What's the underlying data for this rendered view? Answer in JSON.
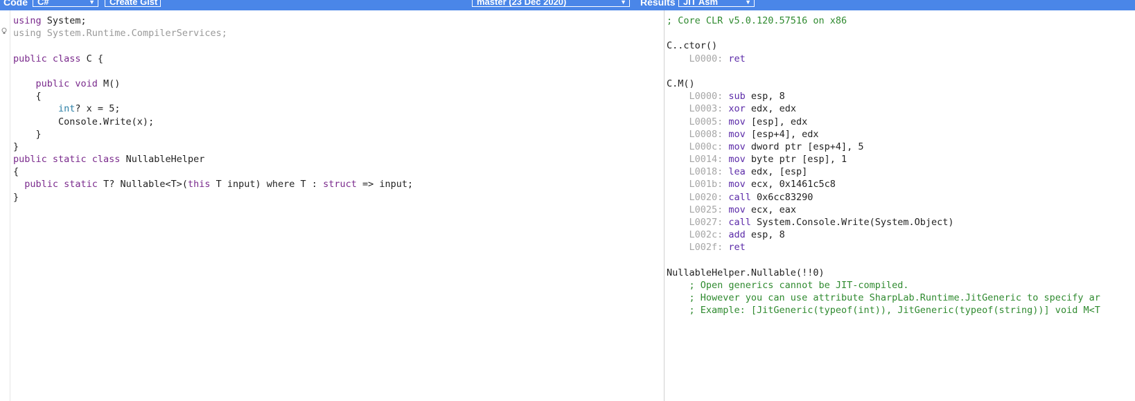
{
  "toolbar": {
    "code_label": "Code",
    "language_value": "C#",
    "create_gist_label": "Create Gist",
    "branch_value": "master (23 Dec 2020)",
    "results_label": "Results",
    "output_value": "JIT Asm"
  },
  "icons": {
    "lightbulb": "lightbulb-icon",
    "dropdown": "chevron-down-icon"
  },
  "colors": {
    "toolbar_bg": "#4a86e8",
    "keyword": "#7a2a8c",
    "type": "#2c7fa6",
    "comment": "#2f8a2f",
    "address": "#a6a6a6"
  },
  "source_code": [
    [
      {
        "t": "using",
        "c": "kw"
      },
      {
        "t": " System;",
        "c": ""
      }
    ],
    [
      {
        "t": "using",
        "c": "dim"
      },
      {
        "t": " System.Runtime.CompilerServices;",
        "c": "dim"
      }
    ],
    [],
    [
      {
        "t": "public class",
        "c": "kw"
      },
      {
        "t": " C {",
        "c": ""
      }
    ],
    [],
    [
      {
        "t": "    ",
        "c": ""
      },
      {
        "t": "public void",
        "c": "kw"
      },
      {
        "t": " M()",
        "c": ""
      }
    ],
    [
      {
        "t": "    {",
        "c": ""
      }
    ],
    [
      {
        "t": "        ",
        "c": ""
      },
      {
        "t": "int",
        "c": "ty"
      },
      {
        "t": "? x = 5;",
        "c": ""
      }
    ],
    [
      {
        "t": "        Console.Write(x);",
        "c": ""
      }
    ],
    [
      {
        "t": "    }",
        "c": ""
      }
    ],
    [
      {
        "t": "}",
        "c": ""
      }
    ],
    [
      {
        "t": "public static class",
        "c": "kw"
      },
      {
        "t": " NullableHelper",
        "c": ""
      }
    ],
    [
      {
        "t": "{",
        "c": ""
      }
    ],
    [
      {
        "t": "  ",
        "c": ""
      },
      {
        "t": "public static",
        "c": "kw"
      },
      {
        "t": " T? Nullable<T>(",
        "c": ""
      },
      {
        "t": "this",
        "c": "kw"
      },
      {
        "t": " T input) where T : ",
        "c": ""
      },
      {
        "t": "struct",
        "c": "kw"
      },
      {
        "t": " => input;",
        "c": ""
      }
    ],
    [
      {
        "t": "}",
        "c": ""
      }
    ]
  ],
  "jit_output": [
    [
      {
        "t": "; Core CLR v5.0.120.57516 on x86",
        "c": "cm"
      }
    ],
    [],
    [
      {
        "t": "C..ctor()",
        "c": ""
      }
    ],
    [
      {
        "t": "    L0000: ",
        "c": "lbl"
      },
      {
        "t": "ret",
        "c": "op"
      }
    ],
    [],
    [
      {
        "t": "C.M()",
        "c": ""
      }
    ],
    [
      {
        "t": "    L0000: ",
        "c": "lbl"
      },
      {
        "t": "sub",
        "c": "op"
      },
      {
        "t": " esp, 8",
        "c": ""
      }
    ],
    [
      {
        "t": "    L0003: ",
        "c": "lbl"
      },
      {
        "t": "xor",
        "c": "op"
      },
      {
        "t": " edx, edx",
        "c": ""
      }
    ],
    [
      {
        "t": "    L0005: ",
        "c": "lbl"
      },
      {
        "t": "mov",
        "c": "op"
      },
      {
        "t": " [esp], edx",
        "c": ""
      }
    ],
    [
      {
        "t": "    L0008: ",
        "c": "lbl"
      },
      {
        "t": "mov",
        "c": "op"
      },
      {
        "t": " [esp+4], edx",
        "c": ""
      }
    ],
    [
      {
        "t": "    L000c: ",
        "c": "lbl"
      },
      {
        "t": "mov",
        "c": "op"
      },
      {
        "t": " dword ptr [esp+4], 5",
        "c": ""
      }
    ],
    [
      {
        "t": "    L0014: ",
        "c": "lbl"
      },
      {
        "t": "mov",
        "c": "op"
      },
      {
        "t": " byte ptr [esp], 1",
        "c": ""
      }
    ],
    [
      {
        "t": "    L0018: ",
        "c": "lbl"
      },
      {
        "t": "lea",
        "c": "op"
      },
      {
        "t": " edx, [esp]",
        "c": ""
      }
    ],
    [
      {
        "t": "    L001b: ",
        "c": "lbl"
      },
      {
        "t": "mov",
        "c": "op"
      },
      {
        "t": " ecx, 0x1461c5c8",
        "c": ""
      }
    ],
    [
      {
        "t": "    L0020: ",
        "c": "lbl"
      },
      {
        "t": "call",
        "c": "op"
      },
      {
        "t": " 0x6cc83290",
        "c": ""
      }
    ],
    [
      {
        "t": "    L0025: ",
        "c": "lbl"
      },
      {
        "t": "mov",
        "c": "op"
      },
      {
        "t": " ecx, eax",
        "c": ""
      }
    ],
    [
      {
        "t": "    L0027: ",
        "c": "lbl"
      },
      {
        "t": "call",
        "c": "op"
      },
      {
        "t": " System.Console.Write(System.Object)",
        "c": ""
      }
    ],
    [
      {
        "t": "    L002c: ",
        "c": "lbl"
      },
      {
        "t": "add",
        "c": "op"
      },
      {
        "t": " esp, 8",
        "c": ""
      }
    ],
    [
      {
        "t": "    L002f: ",
        "c": "lbl"
      },
      {
        "t": "ret",
        "c": "op"
      }
    ],
    [],
    [
      {
        "t": "NullableHelper.Nullable(!!0)",
        "c": ""
      }
    ],
    [
      {
        "t": "    ; Open generics cannot be JIT-compiled.",
        "c": "cm"
      }
    ],
    [
      {
        "t": "    ; However you can use attribute SharpLab.Runtime.JitGeneric to specify ar",
        "c": "cm"
      }
    ],
    [
      {
        "t": "    ; Example: [JitGeneric(typeof(int)), JitGeneric(typeof(string))] void M<T",
        "c": "cm"
      }
    ]
  ]
}
